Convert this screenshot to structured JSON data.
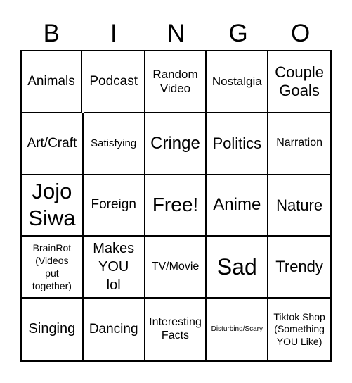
{
  "header": {
    "letters": [
      "B",
      "I",
      "N",
      "G",
      "O"
    ]
  },
  "grid": {
    "cells": [
      [
        "Animals",
        "Podcast",
        "Random Video",
        "Nostalgia",
        "Couple Goals"
      ],
      [
        "Art/Craft",
        "Satisfying",
        "Cringe",
        "Politics",
        "Narration"
      ],
      [
        "Jojo Siwa",
        "Foreign",
        "Free!",
        "Anime",
        "Nature"
      ],
      [
        "BrainRot (Videos put together)",
        "Makes YOU lol",
        "TV/Movie",
        "Sad",
        "Trendy"
      ],
      [
        "Singing",
        "Dancing",
        "Interesting Facts",
        "Disturbing/Scary",
        "Tiktok Shop (Something YOU Like)"
      ]
    ]
  }
}
